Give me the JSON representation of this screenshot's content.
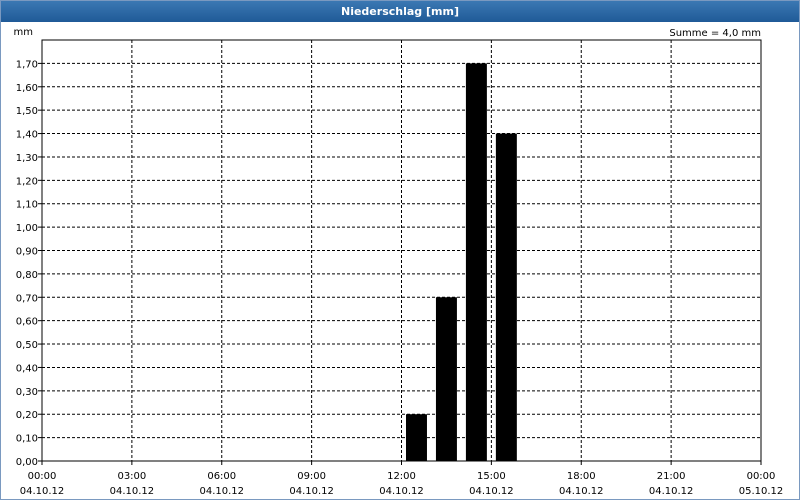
{
  "window": {
    "title": "Niederschlag [mm]"
  },
  "chart_data": {
    "type": "bar",
    "title": "Niederschlag [mm]",
    "ylabel": "mm",
    "annotation": "Summe = 4,0 mm",
    "ylim": [
      0,
      1.8
    ],
    "yticks": [
      "0,00",
      "0,10",
      "0,20",
      "0,30",
      "0,40",
      "0,50",
      "0,60",
      "0,70",
      "0,80",
      "0,90",
      "1,00",
      "1,10",
      "1,20",
      "1,30",
      "1,40",
      "1,50",
      "1,60",
      "1,70"
    ],
    "xrange_hours": [
      0,
      24
    ],
    "xticks": [
      {
        "time": "00:00",
        "date": "04.10.12"
      },
      {
        "time": "03:00",
        "date": "04.10.12"
      },
      {
        "time": "06:00",
        "date": "04.10.12"
      },
      {
        "time": "09:00",
        "date": "04.10.12"
      },
      {
        "time": "12:00",
        "date": "04.10.12"
      },
      {
        "time": "15:00",
        "date": "04.10.12"
      },
      {
        "time": "18:00",
        "date": "04.10.12"
      },
      {
        "time": "21:00",
        "date": "04.10.12"
      },
      {
        "time": "00:00",
        "date": "05.10.12"
      }
    ],
    "categories": [
      "12:00",
      "13:00",
      "14:00",
      "15:00"
    ],
    "x_hours": [
      12,
      13,
      14,
      15
    ],
    "values": [
      0.2,
      0.7,
      1.7,
      1.4
    ],
    "bar_color": "#000000",
    "grid": true
  }
}
